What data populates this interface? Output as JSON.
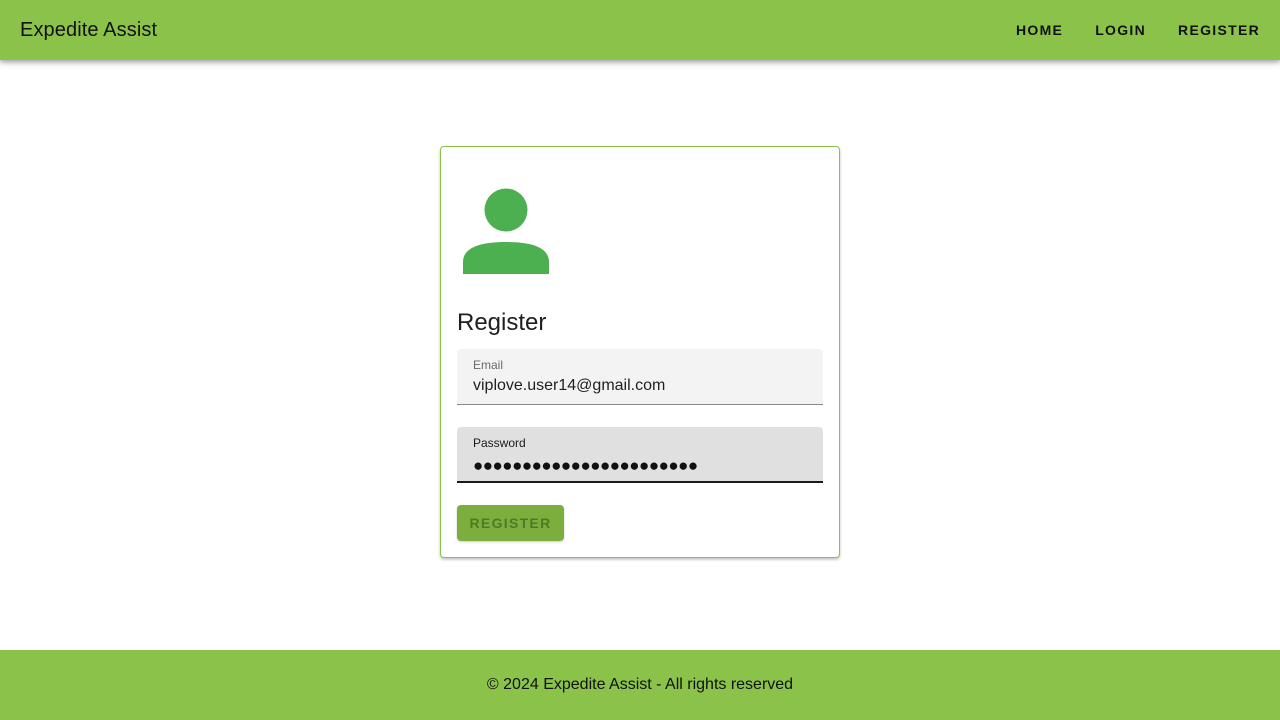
{
  "appbar": {
    "title": "Expedite Assist",
    "nav": [
      {
        "label": "HOME"
      },
      {
        "label": "LOGIN"
      },
      {
        "label": "REGISTER"
      }
    ]
  },
  "form": {
    "icon": "person-icon",
    "title": "Register",
    "email": {
      "label": "Email",
      "value": "viplove.user14@gmail.com"
    },
    "password": {
      "label": "Password",
      "masked_value": "●●●●●●●●●●●●●●●●●●●●●●●"
    },
    "submit_label": "REGISTER"
  },
  "footer": {
    "text": "© 2024 Expedite Assist - All rights reserved"
  },
  "colors": {
    "primary": "#8bc34a",
    "avatar": "#4caf50",
    "button": "#7cae3e"
  }
}
